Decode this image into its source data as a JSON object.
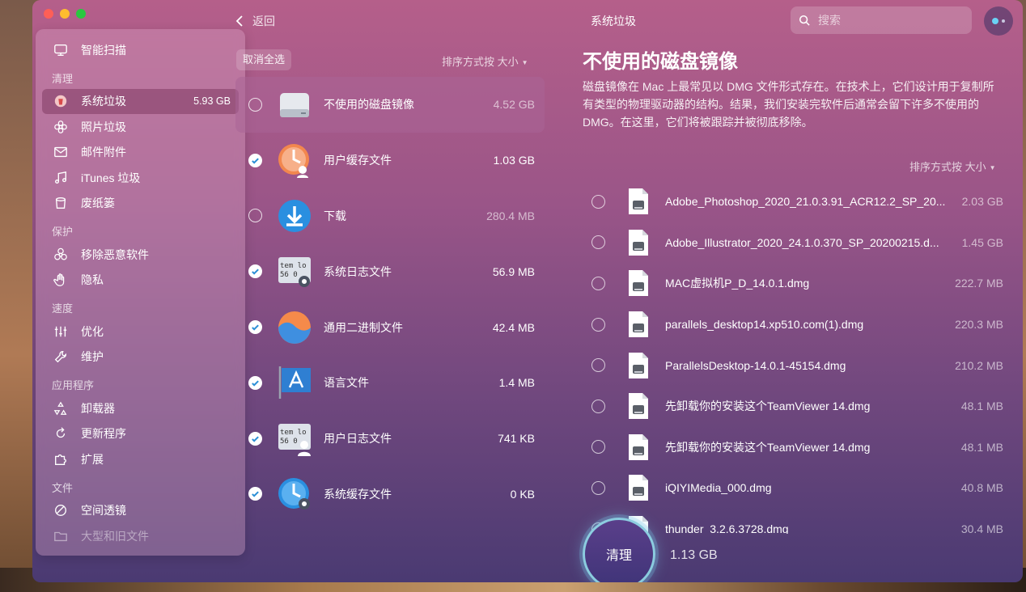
{
  "window": {
    "title": "系统垃圾",
    "back_label": "返回"
  },
  "search": {
    "placeholder": "搜索"
  },
  "sidebar": {
    "top_item": {
      "label": "智能扫描",
      "icon": "monitor-scan-icon"
    },
    "sections": [
      {
        "title": "清理",
        "items": [
          {
            "label": "系统垃圾",
            "icon": "trash-can-icon",
            "size": "5.93 GB",
            "active": true
          },
          {
            "label": "照片垃圾",
            "icon": "flower-icon"
          },
          {
            "label": "邮件附件",
            "icon": "envelope-icon"
          },
          {
            "label": "iTunes 垃圾",
            "icon": "music-note-icon"
          },
          {
            "label": "废纸篓",
            "icon": "bin-icon"
          }
        ]
      },
      {
        "title": "保护",
        "items": [
          {
            "label": "移除恶意软件",
            "icon": "biohazard-icon"
          },
          {
            "label": "隐私",
            "icon": "hand-icon"
          }
        ]
      },
      {
        "title": "速度",
        "items": [
          {
            "label": "优化",
            "icon": "sliders-icon"
          },
          {
            "label": "维护",
            "icon": "wrench-icon"
          }
        ]
      },
      {
        "title": "应用程序",
        "items": [
          {
            "label": "卸载器",
            "icon": "uninstall-icon"
          },
          {
            "label": "更新程序",
            "icon": "update-icon"
          },
          {
            "label": "扩展",
            "icon": "puzzle-icon"
          }
        ]
      },
      {
        "title": "文件",
        "items": [
          {
            "label": "空间透镜",
            "icon": "lens-icon"
          },
          {
            "label": "大型和旧文件",
            "icon": "folder-icon"
          }
        ]
      }
    ]
  },
  "middle": {
    "deselect_label": "取消全选",
    "sort_label": "排序方式按 大小",
    "categories": [
      {
        "name": "不使用的磁盘镜像",
        "size": "4.52 GB",
        "checked": false,
        "selected": true,
        "icon": "disk-image-icon"
      },
      {
        "name": "用户缓存文件",
        "size": "1.03 GB",
        "checked": true,
        "icon": "user-cache-clock-icon"
      },
      {
        "name": "下载",
        "size": "280.4 MB",
        "checked": false,
        "icon": "download-icon"
      },
      {
        "name": "系统日志文件",
        "size": "56.9 MB",
        "checked": true,
        "icon": "system-log-icon"
      },
      {
        "name": "通用二进制文件",
        "size": "42.4 MB",
        "checked": true,
        "icon": "universal-binary-icon"
      },
      {
        "name": "语言文件",
        "size": "1.4 MB",
        "checked": true,
        "icon": "language-flag-icon"
      },
      {
        "name": "用户日志文件",
        "size": "741 KB",
        "checked": true,
        "icon": "user-log-icon"
      },
      {
        "name": "系统缓存文件",
        "size": "0 KB",
        "checked": true,
        "icon": "system-cache-clock-icon"
      }
    ]
  },
  "detail": {
    "title": "不使用的磁盘镜像",
    "description": "磁盘镜像在 Mac 上最常见以 DMG 文件形式存在。在技术上，它们设计用于复制所有类型的物理驱动器的结构。结果，我们安装完软件后通常会留下许多不使用的 DMG。在这里，它们将被跟踪并被彻底移除。",
    "sort_label": "排序方式按 大小",
    "files": [
      {
        "name": "Adobe_Photoshop_2020_21.0.3.91_ACR12.2_SP_20...",
        "size": "2.03 GB"
      },
      {
        "name": "Adobe_Illustrator_2020_24.1.0.370_SP_20200215.d...",
        "size": "1.45 GB"
      },
      {
        "name": "MAC虚拟机P_D_14.0.1.dmg",
        "size": "222.7 MB"
      },
      {
        "name": "parallels_desktop14.xp510.com(1).dmg",
        "size": "220.3 MB"
      },
      {
        "name": "ParallelsDesktop-14.0.1-45154.dmg",
        "size": "210.2 MB"
      },
      {
        "name": "先卸载你的安装这个TeamViewer 14.dmg",
        "size": "48.1 MB"
      },
      {
        "name": "先卸载你的安装这个TeamViewer 14.dmg",
        "size": "48.1 MB"
      },
      {
        "name": "iQIYIMedia_000.dmg",
        "size": "40.8 MB"
      },
      {
        "name": "thunder_3.2.6.3728.dmg",
        "size": "30.4 MB"
      }
    ]
  },
  "action": {
    "clean_label": "清理",
    "total_size": "1.13 GB"
  },
  "colors": {
    "accent_check": "#2b8fd6",
    "clean_ring": "#96e6f0"
  }
}
